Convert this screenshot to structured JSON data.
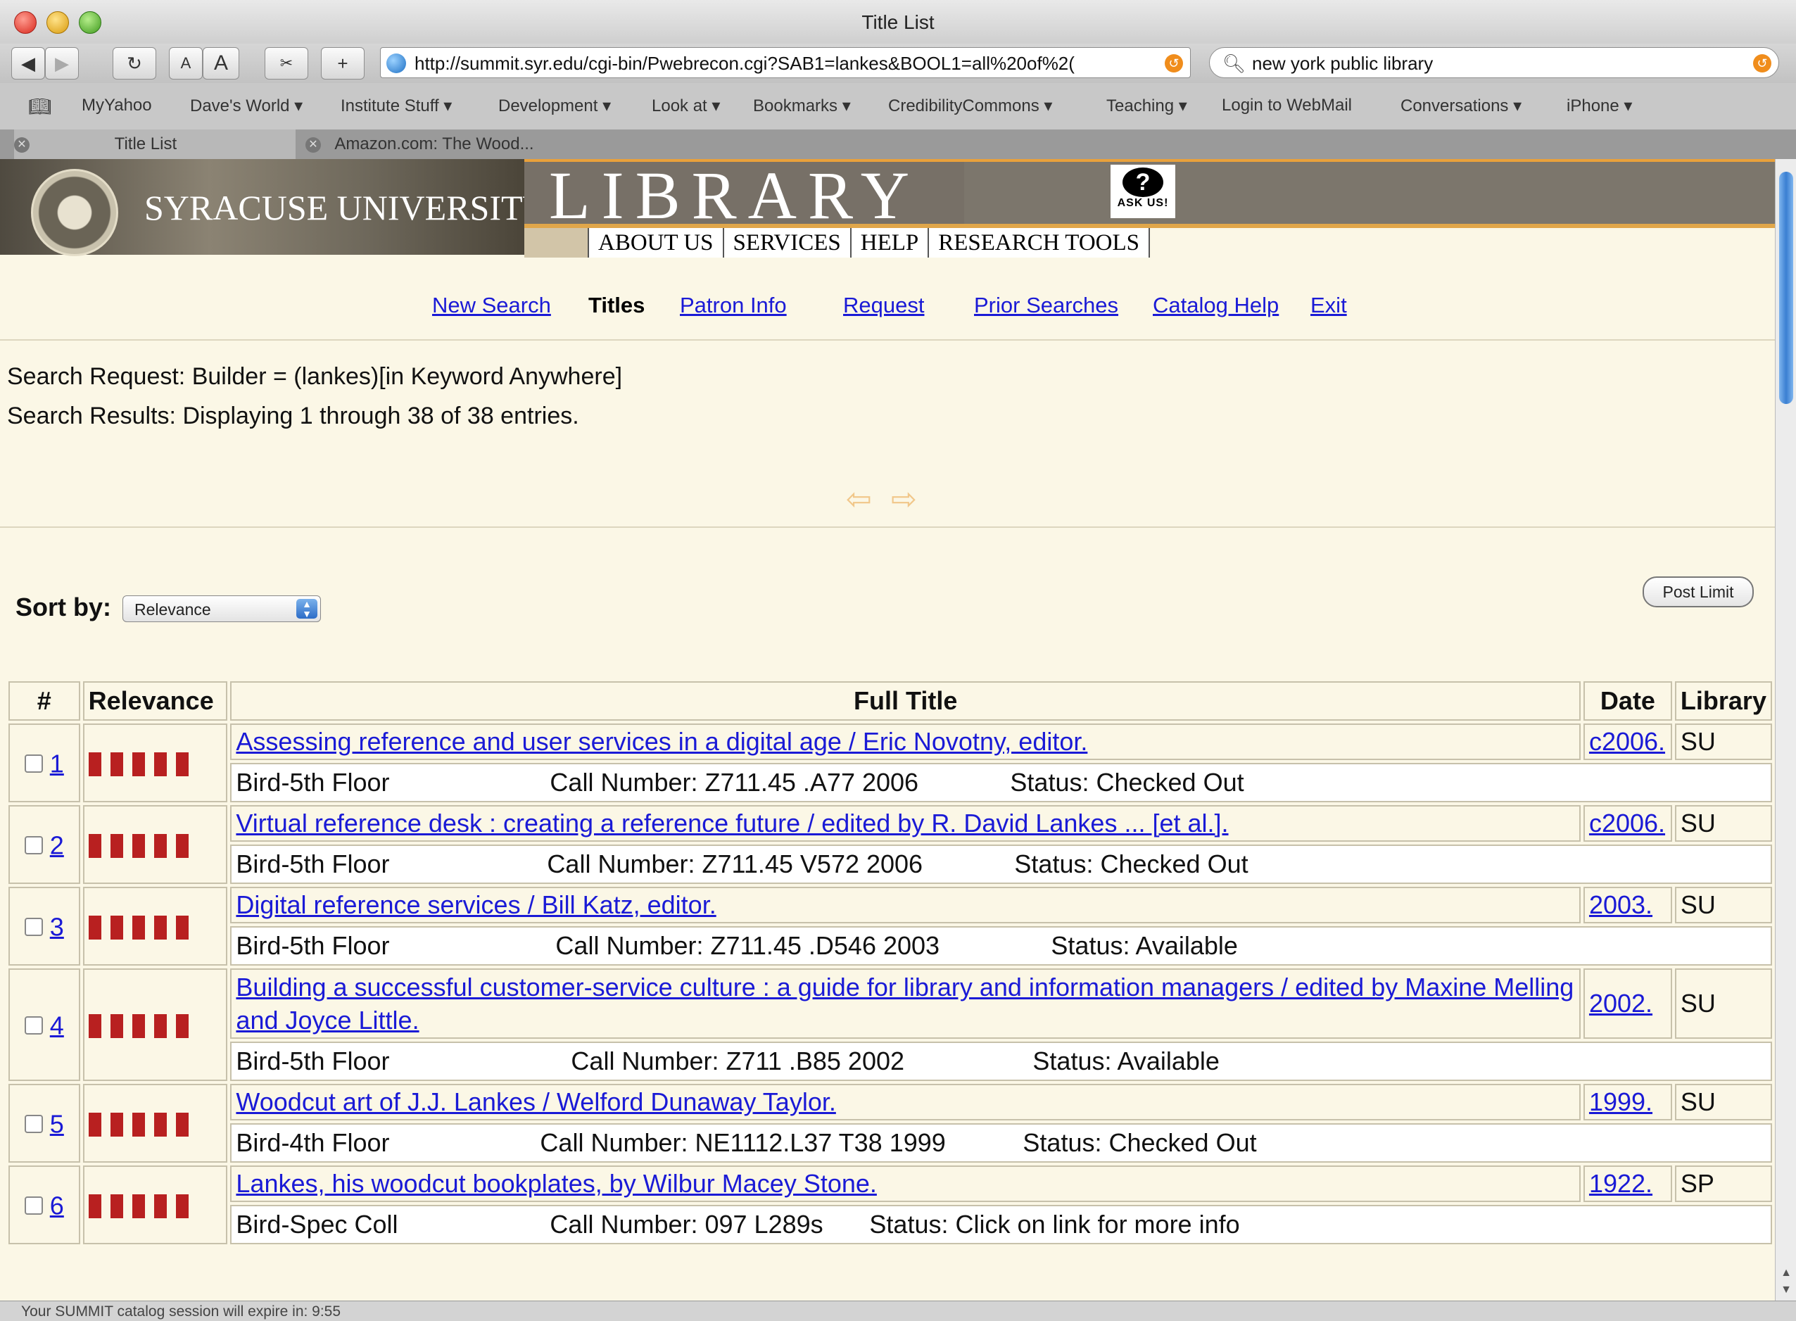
{
  "window": {
    "title": "Title List"
  },
  "toolbar": {
    "back": "◀",
    "forward": "▶",
    "reload": "↻",
    "text_smaller": "A",
    "text_bigger": "A",
    "plus": "+",
    "url": "http://summit.syr.edu/cgi-bin/Pwebrecon.cgi?SAB1=lankes&BOOL1=all%20of%2(",
    "search_value": "new york public library"
  },
  "bookmarks": [
    "MyYahoo",
    "Dave's World ▾",
    "Institute Stuff ▾",
    "Development ▾",
    "Look at ▾",
    "Bookmarks ▾",
    "CredibilityCommons ▾",
    "Teaching ▾",
    "Login to WebMail",
    "Conversations ▾",
    "iPhone ▾"
  ],
  "tabs": [
    {
      "label": "Title List"
    },
    {
      "label": "Amazon.com: The Wood..."
    }
  ],
  "header": {
    "university": "SYRACUSE UNIVERSITY",
    "library": "LIBRARY",
    "ask_us": "ASK US!",
    "nav": [
      "ABOUT US",
      "SERVICES",
      "HELP",
      "RESEARCH TOOLS"
    ]
  },
  "subnav": {
    "new_search": "New Search",
    "titles": "Titles",
    "patron_info": "Patron Info",
    "request": "Request",
    "prior_searches": "Prior Searches",
    "catalog_help": "Catalog Help",
    "exit": "Exit"
  },
  "search": {
    "request": "Search Request: Builder = (lankes)[in Keyword Anywhere]",
    "results": "Search Results: Displaying 1 through 38 of 38 entries."
  },
  "sort": {
    "label": "Sort by:",
    "selected": "Relevance",
    "post_limit": "Post Limit"
  },
  "table": {
    "headers": {
      "num": "#",
      "relevance": "Relevance",
      "full_title": "Full Title",
      "date": "Date",
      "library": "Library"
    },
    "rows": [
      {
        "num": "1",
        "title": "Assessing reference and user services in a digital age / Eric Novotny, editor.",
        "date": "c2006.",
        "library": "SU",
        "location": "Bird-5th Floor",
        "call": "Call Number: Z711.45 .A77 2006",
        "status": "Status: Checked Out"
      },
      {
        "num": "2",
        "title": "Virtual reference desk : creating a reference future / edited by R. David Lankes ... [et al.].",
        "date": "c2006.",
        "library": "SU",
        "location": "Bird-5th Floor",
        "call": "Call Number: Z711.45 V572 2006",
        "status": "Status: Checked Out"
      },
      {
        "num": "3",
        "title": "Digital reference services / Bill Katz, editor.",
        "date": "2003.",
        "library": "SU",
        "location": "Bird-5th Floor",
        "call": "Call Number: Z711.45 .D546 2003",
        "status": "Status: Available"
      },
      {
        "num": "4",
        "title": "Building a successful customer-service culture : a guide for library and information managers / edited by Maxine Melling and Joyce Little.",
        "date": "2002.",
        "library": "SU",
        "location": "Bird-5th Floor",
        "call": "Call Number: Z711 .B85 2002",
        "status": "Status: Available"
      },
      {
        "num": "5",
        "title": "Woodcut art of J.J. Lankes / Welford Dunaway Taylor.",
        "date": "1999.",
        "library": "SU",
        "location": "Bird-4th Floor",
        "call": "Call Number: NE1112.L37 T38 1999",
        "status": "Status: Checked Out"
      },
      {
        "num": "6",
        "title": "Lankes, his woodcut bookplates, by Wilbur Macey Stone.",
        "date": "1922.",
        "library": "SP",
        "location": "Bird-Spec Coll",
        "call": "Call Number: 097 L289s",
        "status": "Status: Click on link for more info"
      }
    ]
  },
  "statusbar": {
    "text": "Your SUMMIT catalog session will expire in: 9:55"
  }
}
